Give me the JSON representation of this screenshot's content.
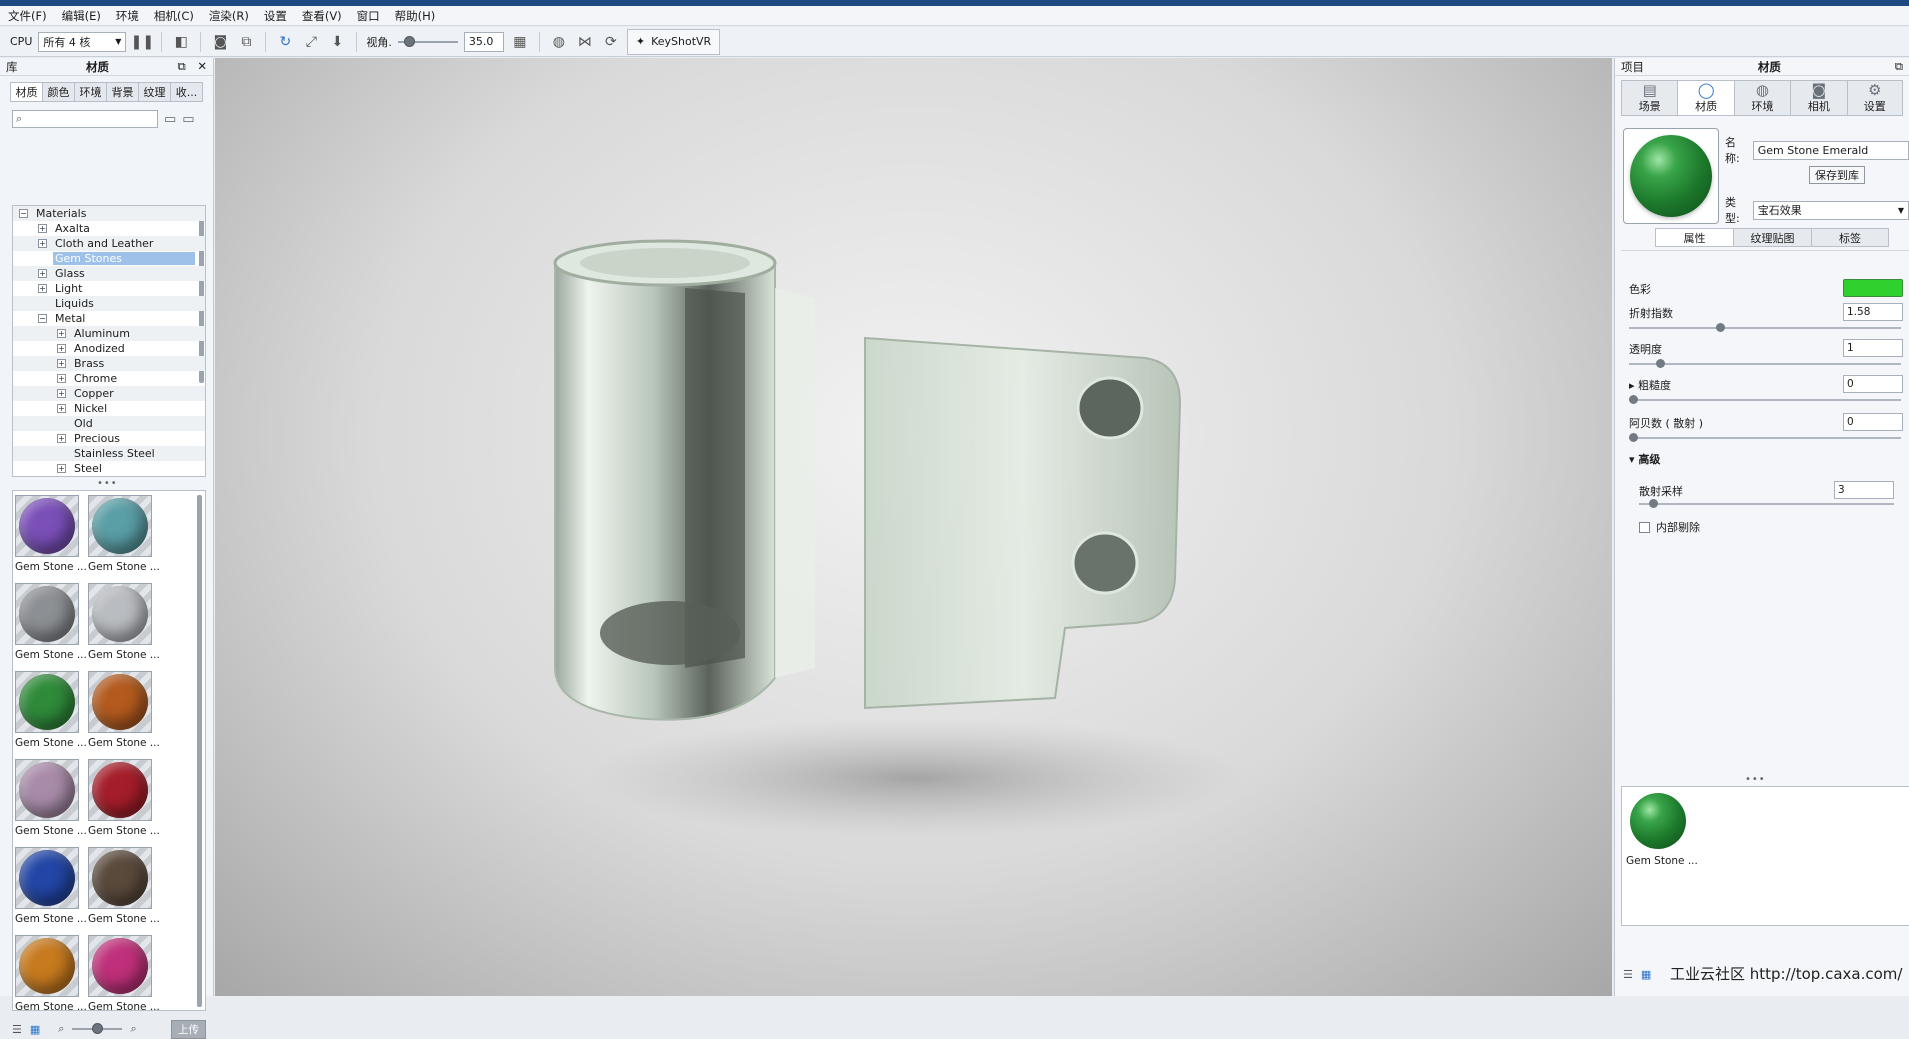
{
  "menubar": [
    "文件(F)",
    "编辑(E)",
    "环境",
    "相机(C)",
    "渲染(R)",
    "设置",
    "查看(V)",
    "窗口",
    "帮助(H)"
  ],
  "toolbar": {
    "cpu_label": "CPU",
    "cores_value": "所有 4 核",
    "fov_label": "视角.",
    "fov_value": "35.0",
    "fov_level": 0.1,
    "keyshotvr_label": "KeyShotVR"
  },
  "library": {
    "header_left": "库",
    "header_title": "材质",
    "tabs": [
      "材质",
      "颜色",
      "环境",
      "背景",
      "纹理",
      "收..."
    ],
    "tree": [
      {
        "label": "Materials",
        "indent": 0,
        "sign": "−"
      },
      {
        "label": "Axalta",
        "indent": 1,
        "sign": "+"
      },
      {
        "label": "Cloth and Leather",
        "indent": 1,
        "sign": "+"
      },
      {
        "label": "Gem Stones",
        "indent": 1,
        "sign": "",
        "selected": true
      },
      {
        "label": "Glass",
        "indent": 1,
        "sign": "+"
      },
      {
        "label": "Light",
        "indent": 1,
        "sign": "+"
      },
      {
        "label": "Liquids",
        "indent": 1,
        "sign": ""
      },
      {
        "label": "Metal",
        "indent": 1,
        "sign": "−"
      },
      {
        "label": "Aluminum",
        "indent": 2,
        "sign": "+"
      },
      {
        "label": "Anodized",
        "indent": 2,
        "sign": "+"
      },
      {
        "label": "Brass",
        "indent": 2,
        "sign": "+"
      },
      {
        "label": "Chrome",
        "indent": 2,
        "sign": "+"
      },
      {
        "label": "Copper",
        "indent": 2,
        "sign": "+"
      },
      {
        "label": "Nickel",
        "indent": 2,
        "sign": "+"
      },
      {
        "label": "Old",
        "indent": 2,
        "sign": ""
      },
      {
        "label": "Precious",
        "indent": 2,
        "sign": "+"
      },
      {
        "label": "Stainless Steel",
        "indent": 2,
        "sign": ""
      },
      {
        "label": "Steel",
        "indent": 2,
        "sign": "+"
      }
    ],
    "thumbnails": [
      {
        "label": "Gem Stone ...",
        "color": "#7a4fb8"
      },
      {
        "label": "Gem Stone ...",
        "color": "#5a9ea6"
      },
      {
        "label": "Gem Stone ...",
        "color": "#8c8f93"
      },
      {
        "label": "Gem Stone ...",
        "color": "#b9bcc0"
      },
      {
        "label": "Gem Stone ...",
        "color": "#2f8b3a"
      },
      {
        "label": "Gem Stone ...",
        "color": "#b35a1e"
      },
      {
        "label": "Gem Stone ...",
        "color": "#a88ba8"
      },
      {
        "label": "Gem Stone ...",
        "color": "#a51d2a"
      },
      {
        "label": "Gem Stone ...",
        "color": "#2346a6"
      },
      {
        "label": "Gem Stone ...",
        "color": "#5a4a3c"
      },
      {
        "label": "Gem Stone ...",
        "color": "#c77a1e"
      },
      {
        "label": "Gem Stone ...",
        "color": "#c0307a"
      }
    ],
    "upload_label": "上传"
  },
  "project": {
    "header_left": "项目",
    "header_title": "材质",
    "tabs": [
      "场景",
      "材质",
      "环境",
      "相机",
      "设置"
    ],
    "name_label": "名称:",
    "name_value": "Gem Stone Emerald",
    "save_button": "保存到库",
    "type_label": "类型:",
    "type_value": "宝石效果",
    "subtabs": [
      "属性",
      "纹理贴图",
      "标签"
    ],
    "props": {
      "color_label": "色彩",
      "color_value": "#2fd12f",
      "refraction_label": "折射指数",
      "refraction_value": "1.58",
      "refraction_level": 0.32,
      "transparency_label": "透明度",
      "transparency_value": "1",
      "transparency_level": 0.1,
      "roughness_label": "粗糙度",
      "roughness_value": "0",
      "abbe_label": "阿贝数 ( 散射 )",
      "abbe_value": "0",
      "advanced_label": "高级",
      "dispersion_samples_label": "散射采样",
      "dispersion_samples_value": "3",
      "dispersion_samples_level": 0.04,
      "internal_cull_label": "内部剔除",
      "internal_cull_checked": false
    },
    "thumbnail_label": "Gem Stone ..."
  },
  "watermark": "工业云社区 http://top.caxa.com/"
}
